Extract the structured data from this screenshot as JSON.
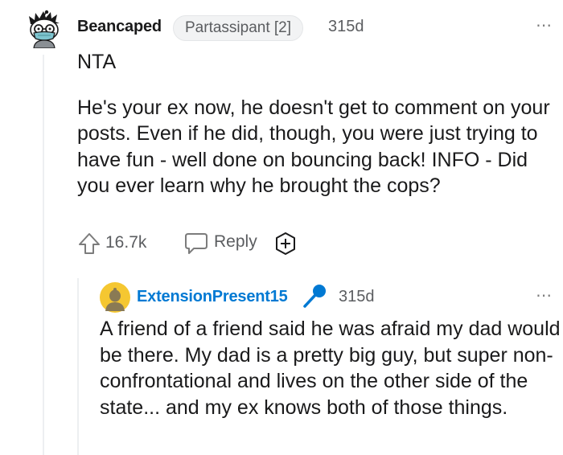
{
  "comment": {
    "author": "Beancaped",
    "flair": "Partassipant [2]",
    "age": "315d",
    "more": "⋯",
    "verdict": "NTA",
    "body": "He's your ex now, he doesn't get to comment on your posts. Even if he did, though, you were just trying to have fun - well done on bouncing back! INFO - Did you ever learn why he brought the cops?",
    "votes": "16.7k",
    "reply_label": "Reply"
  },
  "reply": {
    "author": "ExtensionPresent15",
    "age": "315d",
    "more": "⋯",
    "body": "A friend of a friend said he was afraid my dad would be there. My dad is a pretty big guy, but super non-confrontational and lives on the other side of the state... and my ex knows both of those things."
  },
  "colors": {
    "reply_author": "#0079d3",
    "op_badge": "#0079d3",
    "meta_text": "#5b5d60",
    "thread_line": "#edeff1"
  },
  "icons": {
    "upvote": "upvote-arrow-icon",
    "reply": "speech-bubble-icon",
    "award": "add-award-icon",
    "op": "microphone-icon"
  }
}
